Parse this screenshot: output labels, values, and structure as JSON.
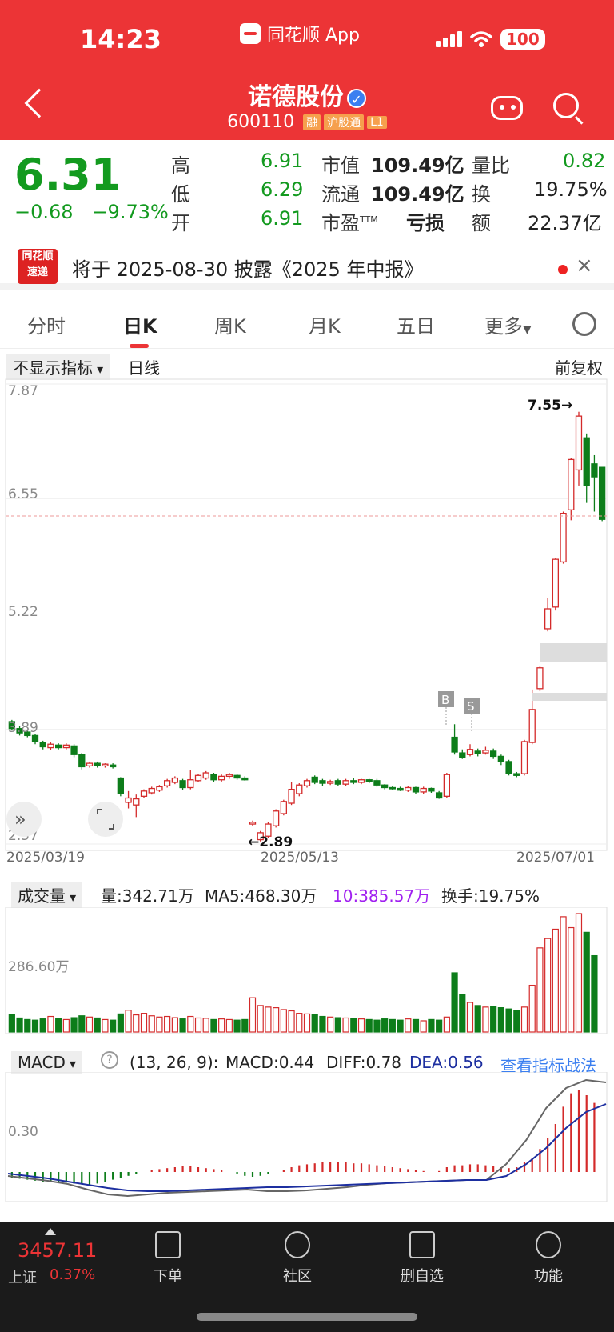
{
  "status": {
    "time": "14:23",
    "app_name": "同花顺 App",
    "battery": "100"
  },
  "header": {
    "title": "诺德股份",
    "code": "600110",
    "tags": [
      "融",
      "沪股通",
      "L1"
    ]
  },
  "quote": {
    "price": "6.31",
    "change": "−0.68",
    "change_pct": "−9.73%",
    "high_label": "高",
    "high": "6.91",
    "low_label": "低",
    "low": "6.29",
    "open_label": "开",
    "open": "6.91",
    "mcap_label": "市值",
    "mcap": "109.49亿",
    "float_label": "流通",
    "float": "109.49亿",
    "pe_label": "市盈",
    "pe_sup": "TTM",
    "pe": "亏损",
    "vol_ratio_label": "量比",
    "vol_ratio": "0.82",
    "turnover_label": "换",
    "turnover": "19.75%",
    "amount_label": "额",
    "amount": "22.37亿"
  },
  "notice": {
    "logo_line1": "同花顺",
    "logo_line2": "速递",
    "text": "将于 2025-08-30 披露《2025 年中报》",
    "close": "×"
  },
  "tabs": [
    "分时",
    "日K",
    "周K",
    "月K",
    "五日",
    "更多"
  ],
  "kline": {
    "indicator_btn": "不显示指标",
    "period": "日线",
    "adjust": "前复权",
    "y_ticks": [
      "7.87",
      "6.55",
      "5.22",
      "3.89",
      "2.57"
    ],
    "x_ticks": [
      "2025/03/19",
      "2025/05/13",
      "2025/07/01"
    ],
    "high_marker": "7.55→",
    "low_marker": "←2.89",
    "buy_marker": "B",
    "sell_marker": "S"
  },
  "volume": {
    "dropdown": "成交量",
    "vol": "量:342.71万",
    "ma5": "MA5:468.30万",
    "ma10": "10:385.57万",
    "turnover": "换手:19.75%",
    "y_tick": "286.60万"
  },
  "macd": {
    "dropdown": "MACD",
    "params": "(13, 26, 9):",
    "macd": "MACD:0.44",
    "diff": "DIFF:0.78",
    "dea": "DEA:0.56",
    "link": "查看指标战法",
    "y_tick": "0.30"
  },
  "bottom": {
    "index_value": "3457.11",
    "index_name": "上证",
    "index_pct": "0.37%",
    "nav": [
      "下单",
      "社区",
      "删自选",
      "功能"
    ]
  },
  "chart_data": {
    "type": "candlestick",
    "title": "",
    "series_name": "",
    "ylim": [
      2.57,
      7.87
    ],
    "y_ticks": [
      7.87,
      6.55,
      5.22,
      3.89,
      2.57
    ],
    "x_ticks": [
      "2025/03/19",
      "2025/05/13",
      "2025/07/01"
    ],
    "candles": [
      {
        "o": 3.98,
        "c": 3.9,
        "h": 4.0,
        "l": 3.88
      },
      {
        "o": 3.9,
        "c": 3.85,
        "h": 3.93,
        "l": 3.82
      },
      {
        "o": 3.86,
        "c": 3.82,
        "h": 3.88,
        "l": 3.8
      },
      {
        "o": 3.82,
        "c": 3.75,
        "h": 3.84,
        "l": 3.72
      },
      {
        "o": 3.74,
        "c": 3.69,
        "h": 3.76,
        "l": 3.66
      },
      {
        "o": 3.68,
        "c": 3.72,
        "h": 3.74,
        "l": 3.65
      },
      {
        "o": 3.71,
        "c": 3.68,
        "h": 3.73,
        "l": 3.66
      },
      {
        "o": 3.68,
        "c": 3.71,
        "h": 3.73,
        "l": 3.66
      },
      {
        "o": 3.7,
        "c": 3.6,
        "h": 3.72,
        "l": 3.57
      },
      {
        "o": 3.6,
        "c": 3.46,
        "h": 3.62,
        "l": 3.43
      },
      {
        "o": 3.47,
        "c": 3.5,
        "h": 3.52,
        "l": 3.45
      },
      {
        "o": 3.5,
        "c": 3.47,
        "h": 3.52,
        "l": 3.45
      },
      {
        "o": 3.47,
        "c": 3.49,
        "h": 3.5,
        "l": 3.45
      },
      {
        "o": 3.48,
        "c": 3.46,
        "h": 3.5,
        "l": 3.44
      },
      {
        "o": 3.33,
        "c": 3.15,
        "h": 3.34,
        "l": 3.12
      },
      {
        "o": 3.05,
        "c": 3.1,
        "h": 3.18,
        "l": 2.98
      },
      {
        "o": 3.02,
        "c": 3.09,
        "h": 3.14,
        "l": 2.88
      },
      {
        "o": 3.12,
        "c": 3.18,
        "h": 3.2,
        "l": 3.1
      },
      {
        "o": 3.16,
        "c": 3.21,
        "h": 3.23,
        "l": 3.14
      },
      {
        "o": 3.19,
        "c": 3.23,
        "h": 3.25,
        "l": 3.17
      },
      {
        "o": 3.24,
        "c": 3.3,
        "h": 3.32,
        "l": 3.22
      },
      {
        "o": 3.28,
        "c": 3.33,
        "h": 3.35,
        "l": 3.26
      },
      {
        "o": 3.3,
        "c": 3.22,
        "h": 3.32,
        "l": 3.19
      },
      {
        "o": 3.22,
        "c": 3.31,
        "h": 3.42,
        "l": 3.2
      },
      {
        "o": 3.3,
        "c": 3.36,
        "h": 3.38,
        "l": 3.28
      },
      {
        "o": 3.33,
        "c": 3.39,
        "h": 3.41,
        "l": 3.31
      },
      {
        "o": 3.37,
        "c": 3.31,
        "h": 3.39,
        "l": 3.28
      },
      {
        "o": 3.31,
        "c": 3.35,
        "h": 3.37,
        "l": 3.29
      },
      {
        "o": 3.35,
        "c": 3.37,
        "h": 3.39,
        "l": 3.32
      },
      {
        "o": 3.36,
        "c": 3.33,
        "h": 3.38,
        "l": 3.31
      },
      {
        "o": 3.33,
        "c": 3.31,
        "h": 3.35,
        "l": 3.3
      },
      {
        "o": 2.8,
        "c": 2.82,
        "h": 2.84,
        "l": 2.78
      },
      {
        "o": 2.62,
        "c": 2.7,
        "h": 2.72,
        "l": 2.6
      },
      {
        "o": 2.66,
        "c": 2.8,
        "h": 2.82,
        "l": 2.64
      },
      {
        "o": 2.78,
        "c": 2.95,
        "h": 2.97,
        "l": 2.76
      },
      {
        "o": 2.92,
        "c": 3.06,
        "h": 3.08,
        "l": 2.9
      },
      {
        "o": 3.04,
        "c": 3.2,
        "h": 3.28,
        "l": 3.02
      },
      {
        "o": 3.15,
        "c": 3.25,
        "h": 3.27,
        "l": 3.12
      },
      {
        "o": 3.24,
        "c": 3.3,
        "h": 3.32,
        "l": 3.22
      },
      {
        "o": 3.34,
        "c": 3.28,
        "h": 3.36,
        "l": 3.26
      },
      {
        "o": 3.3,
        "c": 3.27,
        "h": 3.32,
        "l": 3.24
      },
      {
        "o": 3.27,
        "c": 3.29,
        "h": 3.31,
        "l": 3.25
      },
      {
        "o": 3.3,
        "c": 3.26,
        "h": 3.32,
        "l": 3.24
      },
      {
        "o": 3.26,
        "c": 3.3,
        "h": 3.32,
        "l": 3.24
      },
      {
        "o": 3.3,
        "c": 3.28,
        "h": 3.33,
        "l": 3.26
      },
      {
        "o": 3.28,
        "c": 3.31,
        "h": 3.32,
        "l": 3.26
      },
      {
        "o": 3.31,
        "c": 3.29,
        "h": 3.32,
        "l": 3.27
      },
      {
        "o": 3.3,
        "c": 3.25,
        "h": 3.32,
        "l": 3.23
      },
      {
        "o": 3.25,
        "c": 3.22,
        "h": 3.26,
        "l": 3.2
      },
      {
        "o": 3.22,
        "c": 3.21,
        "h": 3.24,
        "l": 3.19
      },
      {
        "o": 3.21,
        "c": 3.19,
        "h": 3.23,
        "l": 3.18
      },
      {
        "o": 3.19,
        "c": 3.22,
        "h": 3.24,
        "l": 3.17
      },
      {
        "o": 3.22,
        "c": 3.17,
        "h": 3.23,
        "l": 3.15
      },
      {
        "o": 3.17,
        "c": 3.21,
        "h": 3.23,
        "l": 3.15
      },
      {
        "o": 3.21,
        "c": 3.18,
        "h": 3.22,
        "l": 3.16
      },
      {
        "o": 3.16,
        "c": 3.1,
        "h": 3.18,
        "l": 3.09
      },
      {
        "o": 3.12,
        "c": 3.37,
        "h": 3.39,
        "l": 3.1
      },
      {
        "o": 3.8,
        "c": 3.63,
        "h": 3.95,
        "l": 3.6
      },
      {
        "o": 3.62,
        "c": 3.57,
        "h": 3.66,
        "l": 3.55
      },
      {
        "o": 3.6,
        "c": 3.66,
        "h": 3.72,
        "l": 3.58
      },
      {
        "o": 3.64,
        "c": 3.61,
        "h": 3.67,
        "l": 3.58
      },
      {
        "o": 3.62,
        "c": 3.65,
        "h": 3.69,
        "l": 3.6
      },
      {
        "o": 3.64,
        "c": 3.58,
        "h": 3.67,
        "l": 3.55
      },
      {
        "o": 3.58,
        "c": 3.52,
        "h": 3.6,
        "l": 3.48
      },
      {
        "o": 3.52,
        "c": 3.38,
        "h": 3.54,
        "l": 3.36
      },
      {
        "o": 3.38,
        "c": 3.36,
        "h": 3.4,
        "l": 3.34
      },
      {
        "o": 3.38,
        "c": 3.75,
        "h": 3.77,
        "l": 3.36
      },
      {
        "o": 3.74,
        "c": 4.12,
        "h": 4.35,
        "l": 3.72
      },
      {
        "o": 4.36,
        "c": 4.6,
        "h": 4.62,
        "l": 4.33
      },
      {
        "o": 5.05,
        "c": 5.28,
        "h": 5.4,
        "l": 5.02
      },
      {
        "o": 5.3,
        "c": 5.85,
        "h": 5.87,
        "l": 5.26
      },
      {
        "o": 5.82,
        "c": 6.38,
        "h": 6.4,
        "l": 5.8
      },
      {
        "o": 6.42,
        "c": 7.0,
        "h": 7.02,
        "l": 6.3
      },
      {
        "o": 6.88,
        "c": 7.5,
        "h": 7.55,
        "l": 6.7
      },
      {
        "o": 7.25,
        "c": 6.7,
        "h": 7.3,
        "l": 6.5
      },
      {
        "o": 6.95,
        "c": 6.8,
        "h": 7.05,
        "l": 6.4
      },
      {
        "o": 6.91,
        "c": 6.31,
        "h": 6.91,
        "l": 6.29
      }
    ],
    "volume_candles": "one volume bar per candle (relative)",
    "volume_values": [
      55,
      45,
      40,
      38,
      42,
      50,
      44,
      40,
      46,
      52,
      48,
      45,
      40,
      38,
      58,
      70,
      55,
      60,
      52,
      48,
      50,
      46,
      42,
      50,
      45,
      44,
      40,
      42,
      40,
      38,
      40,
      110,
      85,
      80,
      78,
      72,
      68,
      60,
      58,
      55,
      50,
      48,
      46,
      45,
      44,
      42,
      40,
      38,
      42,
      40,
      38,
      42,
      40,
      36,
      40,
      38,
      48,
      190,
      120,
      95,
      85,
      80,
      82,
      78,
      74,
      70,
      80,
      150,
      270,
      300,
      330,
      370,
      335,
      380,
      320,
      245
    ],
    "macd_hist": [
      -0.06,
      -0.07,
      -0.08,
      -0.09,
      -0.1,
      -0.1,
      -0.11,
      -0.11,
      -0.12,
      -0.13,
      -0.13,
      -0.12,
      -0.1,
      -0.08,
      -0.06,
      -0.04,
      -0.02,
      0.0,
      0.02,
      0.03,
      0.04,
      0.05,
      0.06,
      0.06,
      0.05,
      0.04,
      0.03,
      0.02,
      0.0,
      -0.02,
      -0.04,
      -0.05,
      -0.04,
      -0.02,
      0.0,
      0.02,
      0.05,
      0.07,
      0.08,
      0.09,
      0.1,
      0.1,
      0.1,
      0.1,
      0.09,
      0.09,
      0.08,
      0.07,
      0.06,
      0.05,
      0.04,
      0.03,
      0.02,
      0.01,
      0.0,
      0.01,
      0.05,
      0.07,
      0.07,
      0.08,
      0.08,
      0.07,
      0.06,
      0.05,
      0.04,
      0.05,
      0.1,
      0.15,
      0.24,
      0.35,
      0.5,
      0.68,
      0.82,
      0.85,
      0.8,
      0.72
    ],
    "diff_line": [
      -0.05,
      -0.08,
      -0.11,
      -0.15,
      -0.22,
      -0.28,
      -0.3,
      -0.28,
      -0.26,
      -0.25,
      -0.24,
      -0.23,
      -0.22,
      -0.24,
      -0.24,
      -0.23,
      -0.21,
      -0.19,
      -0.16,
      -0.14,
      -0.13,
      -0.12,
      -0.11,
      -0.1,
      -0.1,
      0.1,
      0.4,
      0.8,
      1.05,
      1.15,
      1.12
    ],
    "dea_line": [
      -0.02,
      -0.05,
      -0.08,
      -0.12,
      -0.16,
      -0.2,
      -0.23,
      -0.24,
      -0.24,
      -0.23,
      -0.22,
      -0.21,
      -0.2,
      -0.19,
      -0.19,
      -0.18,
      -0.17,
      -0.16,
      -0.15,
      -0.14,
      -0.13,
      -0.12,
      -0.11,
      -0.1,
      -0.1,
      -0.05,
      0.1,
      0.3,
      0.55,
      0.75,
      0.85
    ]
  }
}
